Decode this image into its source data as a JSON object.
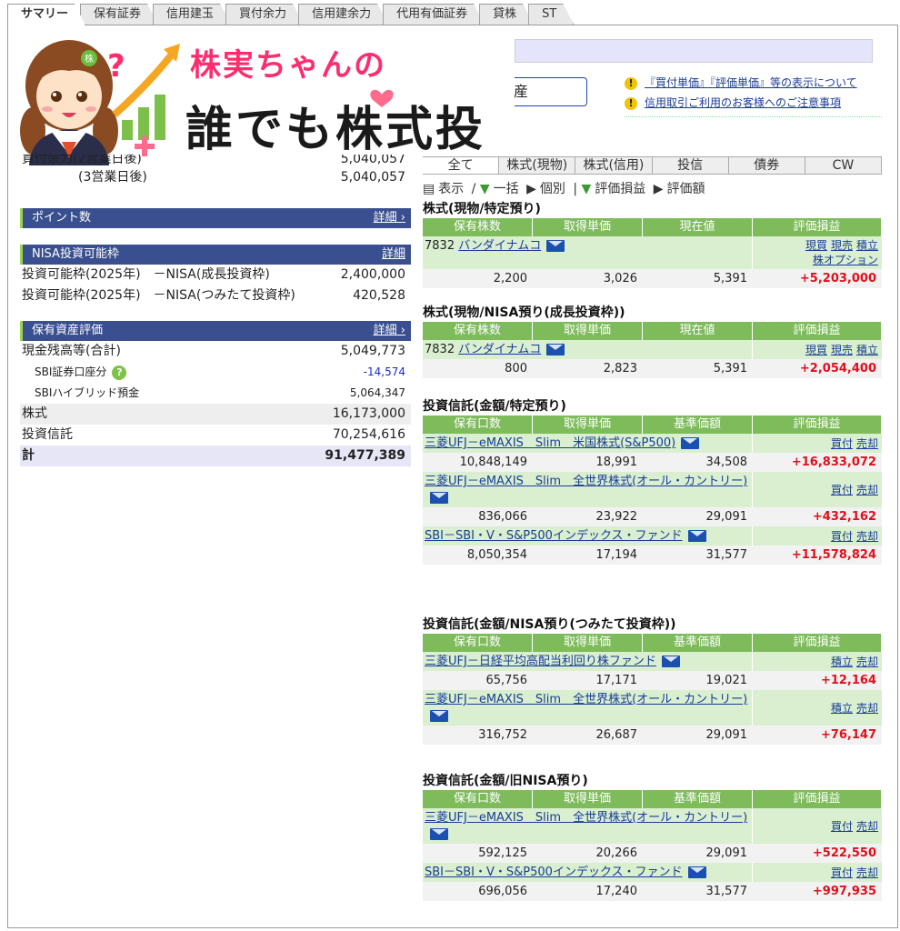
{
  "tabs": [
    "サマリー",
    "保有証券",
    "信用建玉",
    "買付余力",
    "信用建余力",
    "代用有価証券",
    "貸株",
    "ST"
  ],
  "banner": {
    "line1": "株実ちゃんの",
    "line2": "誰でも株式投資"
  },
  "asset_button": "産",
  "notices": [
    "『買付単価』『評価単価』等の表示について",
    "信用取引ご利用のお客様へのご注意事項"
  ],
  "left": {
    "buy_power_partial_label": "買付余力(2営業日後)",
    "buy_power_partial_value": "5,040,057",
    "buy_power_3_label": "(3営業日後)",
    "buy_power_3_value": "5,040,057",
    "points_title": "ポイント数",
    "detail": "詳細",
    "nisa_title": "NISA投資可能枠",
    "nisa_rows": [
      {
        "label": "投資可能枠(2025年)　－NISA(成長投資枠)",
        "value": "2,400,000"
      },
      {
        "label": "投資可能枠(2025年)　－NISA(つみたて投資枠)",
        "value": "420,528"
      }
    ],
    "asset_title": "保有資産評価",
    "cash_label": "現金残高等(合計)",
    "cash_value": "5,049,773",
    "sbi_label": "SBI証券口座分",
    "sbi_value": "-14,574",
    "hybrid_label": "SBIハイブリッド預金",
    "hybrid_value": "5,064,347",
    "stock_label": "株式",
    "stock_value": "16,173,000",
    "fund_label": "投資信託",
    "fund_value": "70,254,616",
    "total_label": "計",
    "total_value": "91,477,389"
  },
  "right_tabs": [
    "全て",
    "株式(現物)",
    "株式(信用)",
    "投信",
    "債券",
    "CW"
  ],
  "controls": {
    "display": "表示",
    "all": "一括",
    "each": "個別",
    "pl": "評価損益",
    "amt": "評価額"
  },
  "sections": [
    {
      "title": "株式(現物/特定預り)",
      "headers": [
        "保有株数",
        "取得単価",
        "現在値",
        "評価損益"
      ],
      "items": [
        {
          "code": "7832",
          "name": "バンダイナムコ",
          "actions": [
            "現買",
            "現売",
            "積立",
            "株オプション"
          ],
          "vals": [
            "2,200",
            "3,026",
            "5,391",
            "+5,203,000"
          ]
        }
      ]
    },
    {
      "title": "株式(現物/NISA預り(成長投資枠))",
      "headers": [
        "保有株数",
        "取得単価",
        "現在値",
        "評価損益"
      ],
      "items": [
        {
          "code": "7832",
          "name": "バンダイナムコ",
          "actions": [
            "現買",
            "現売",
            "積立"
          ],
          "vals": [
            "800",
            "2,823",
            "5,391",
            "+2,054,400"
          ]
        }
      ]
    },
    {
      "title": "投資信託(金額/特定預り)",
      "headers": [
        "保有口数",
        "取得単価",
        "基準価額",
        "評価損益"
      ],
      "items": [
        {
          "name": "三菱UFJ－eMAXIS　Slim　米国株式(S&P500)",
          "actions": [
            "買付",
            "売却"
          ],
          "vals": [
            "10,848,149",
            "18,991",
            "34,508",
            "+16,833,072"
          ]
        },
        {
          "name": "三菱UFJ－eMAXIS　Slim　全世界株式(オール・カントリー)",
          "actions": [
            "買付",
            "売却"
          ],
          "vals": [
            "836,066",
            "23,922",
            "29,091",
            "+432,162"
          ]
        },
        {
          "name": "SBI－SBI・V・S&P500インデックス・ファンド",
          "actions": [
            "買付",
            "売却"
          ],
          "vals": [
            "8,050,354",
            "17,194",
            "31,577",
            "+11,578,824"
          ]
        }
      ]
    },
    {
      "title": "投資信託(金額/NISA預り(つみたて投資枠))",
      "headers": [
        "保有口数",
        "取得単価",
        "基準価額",
        "評価損益"
      ],
      "items": [
        {
          "name": "三菱UFJ－日経平均高配当利回り株ファンド",
          "actions": [
            "積立",
            "売却"
          ],
          "vals": [
            "65,756",
            "17,171",
            "19,021",
            "+12,164"
          ]
        },
        {
          "name": "三菱UFJ－eMAXIS　Slim　全世界株式(オール・カントリー)",
          "actions": [
            "積立",
            "売却"
          ],
          "vals": [
            "316,752",
            "26,687",
            "29,091",
            "+76,147"
          ]
        }
      ]
    },
    {
      "title": "投資信託(金額/旧NISA預り)",
      "headers": [
        "保有口数",
        "取得単価",
        "基準価額",
        "評価損益"
      ],
      "items": [
        {
          "name": "三菱UFJ－eMAXIS　Slim　全世界株式(オール・カントリー)",
          "actions": [
            "買付",
            "売却"
          ],
          "vals": [
            "592,125",
            "20,266",
            "29,091",
            "+522,550"
          ]
        },
        {
          "name": "SBI－SBI・V・S&P500インデックス・ファンド",
          "actions": [
            "買付",
            "売却"
          ],
          "vals": [
            "696,056",
            "17,240",
            "31,577",
            "+997,935"
          ]
        }
      ]
    }
  ]
}
